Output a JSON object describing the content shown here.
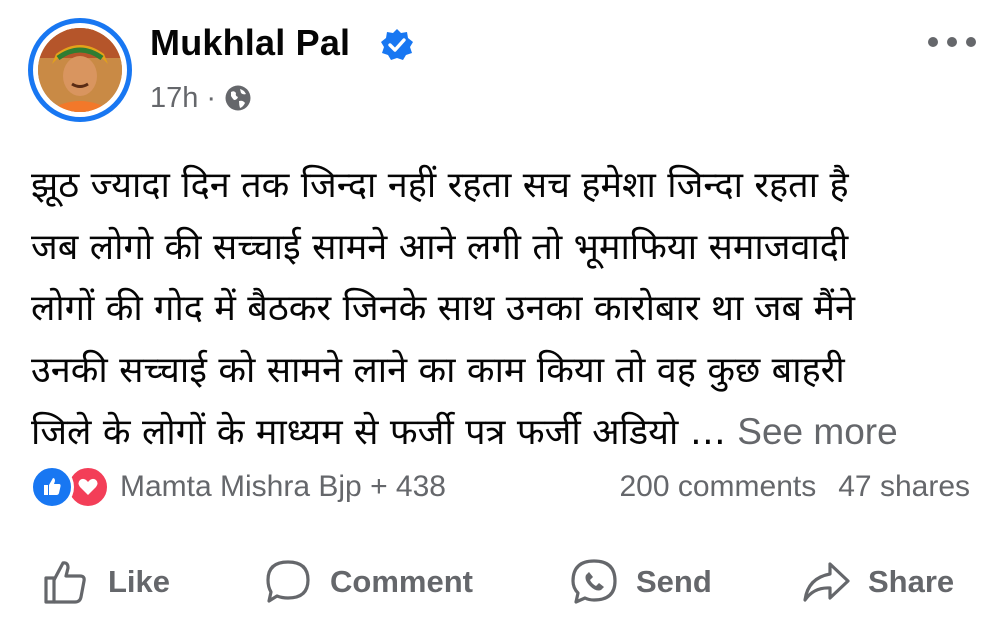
{
  "post": {
    "author_name": "Mukhlal Pal",
    "time": "17h",
    "separator": "·",
    "verified": true,
    "privacy_icon": "globe-icon",
    "text_lines": [
      "झूठ ज्यादा दिन तक जिन्दा नहीं रहता सच हमेशा जिन्दा रहता है",
      "जब लोगो की सच्चाई सामने आने लगी तो भूमाफिया समाजवादी",
      "लोगों की गोद में बैठकर जिनके साथ उनका कारोबार था जब मैंने",
      "उनकी सच्चाई को सामने लाने का काम किया तो वह कुछ बाहरी",
      "जिले के लोगों के माध्यम से फर्जी पत्र फर्जी अडियो …"
    ],
    "see_more": "See more"
  },
  "engagement": {
    "reaction_names": "Mamta Mishra Bjp + 438",
    "comments": "200 comments",
    "shares": "47 shares"
  },
  "actions": {
    "like": "Like",
    "comment": "Comment",
    "send": "Send",
    "share": "Share"
  },
  "colors": {
    "accent": "#1877f2",
    "love": "#f33e58",
    "secondary_text": "#65676b",
    "primary_text": "#050505"
  }
}
